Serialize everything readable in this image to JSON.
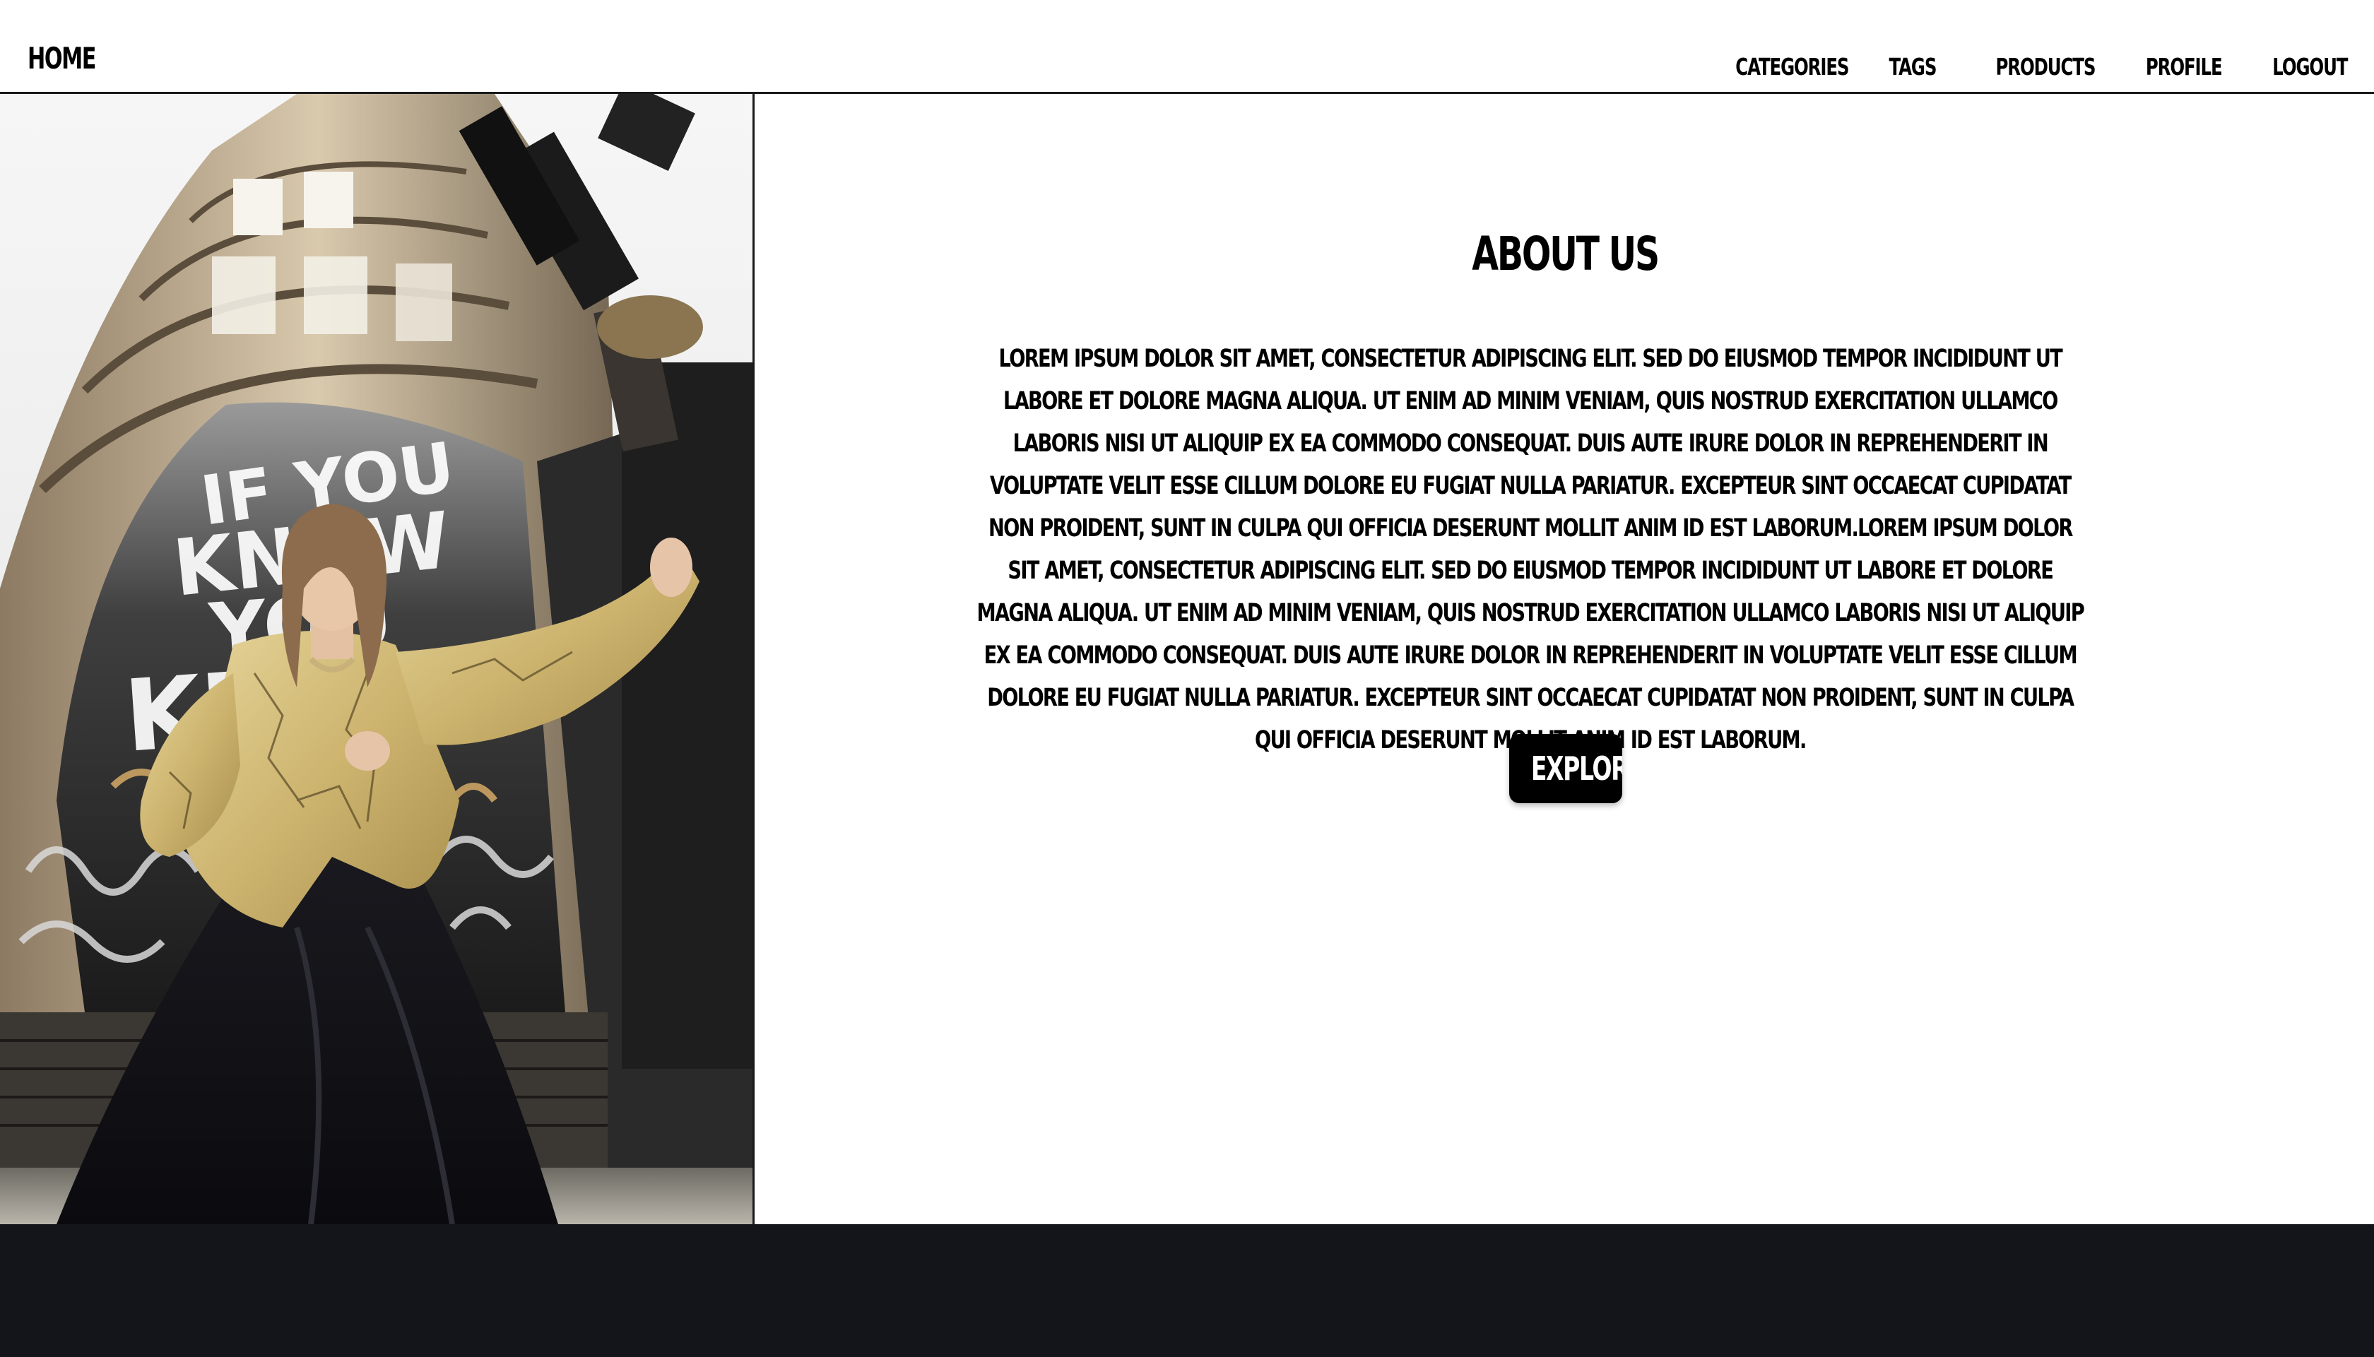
{
  "header": {
    "brand_label": "HOME",
    "nav": [
      {
        "label": "CATEGORIES"
      },
      {
        "label": "TAGS"
      },
      {
        "label": "PRODUCTS"
      },
      {
        "label": "PROFILE"
      },
      {
        "label": "LOGOUT"
      }
    ]
  },
  "hero": {
    "image_alt": "",
    "poster_text": [
      "IF YOU",
      "KNOW",
      "YOU",
      "KNOW"
    ]
  },
  "about": {
    "title": "ABOUT US",
    "body": "LOREM IPSUM DOLOR SIT AMET, CONSECTETUR ADIPISCING ELIT. SED DO EIUSMOD TEMPOR INCIDIDUNT UT LABORE ET DOLORE MAGNA ALIQUA. UT ENIM AD MINIM VENIAM, QUIS NOSTRUD EXERCITATION ULLAMCO LABORIS NISI UT ALIQUIP EX EA COMMODO CONSEQUAT. DUIS AUTE IRURE DOLOR IN REPREHENDERIT IN VOLUPTATE VELIT ESSE CILLUM DOLORE EU FUGIAT NULLA PARIATUR. EXCEPTEUR SINT OCCAECAT CUPIDATAT NON PROIDENT, SUNT IN CULPA QUI OFFICIA DESERUNT MOLLIT ANIM ID EST LABORUM.LOREM IPSUM DOLOR SIT AMET, CONSECTETUR ADIPISCING ELIT. SED DO EIUSMOD TEMPOR INCIDIDUNT UT LABORE ET DOLORE MAGNA ALIQUA. UT ENIM AD MINIM VENIAM, QUIS NOSTRUD EXERCITATION ULLAMCO LABORIS NISI UT ALIQUIP EX EA COMMODO CONSEQUAT. DUIS AUTE IRURE DOLOR IN REPREHENDERIT IN VOLUPTATE VELIT ESSE CILLUM DOLORE EU FUGIAT NULLA PARIATUR. EXCEPTEUR SINT OCCAECAT CUPIDATAT NON PROIDENT, SUNT IN CULPA QUI OFFICIA DESERUNT MOLLIT ANIM ID EST LABORUM.",
    "button_label": "EXPLORE"
  },
  "colors": {
    "text": "#000000",
    "background": "#ffffff",
    "button_bg": "#000000",
    "button_text": "#ffffff",
    "footer_bg": "#13151a"
  }
}
